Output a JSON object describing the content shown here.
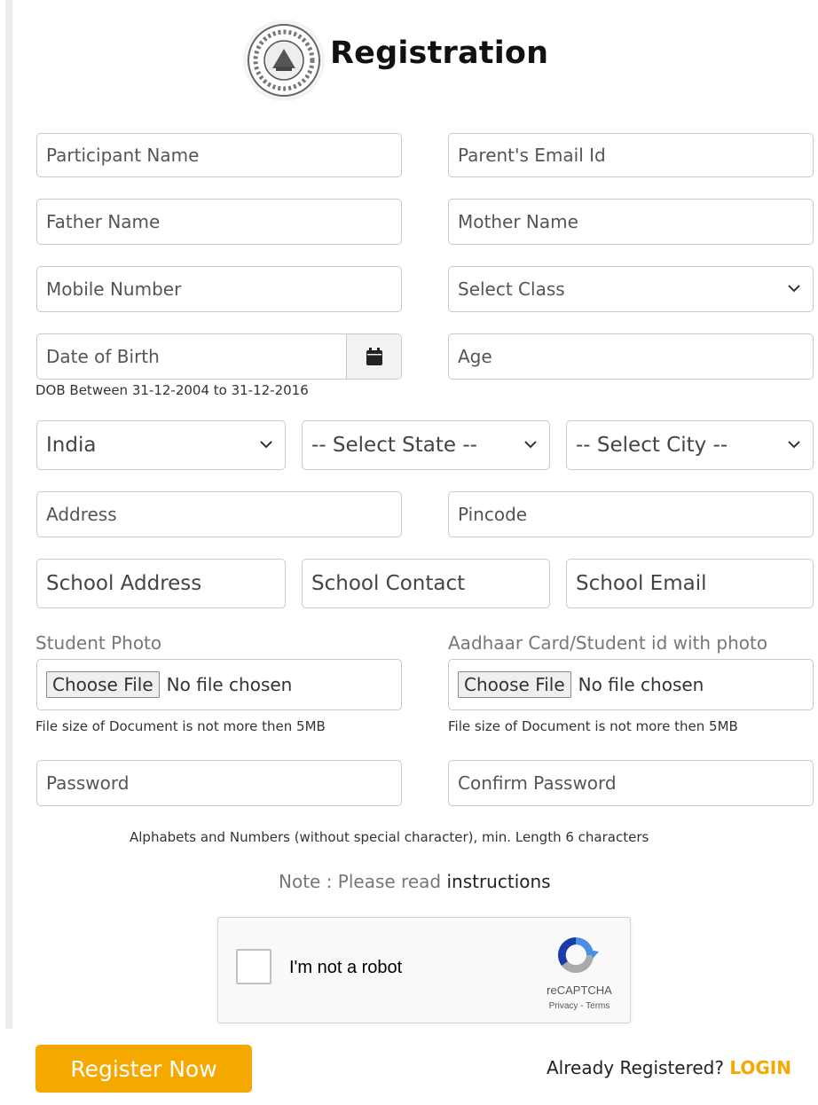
{
  "header": {
    "title": "Registration",
    "logo_icon": "emblem-logo"
  },
  "form": {
    "participant_name": "Participant Name",
    "parent_email": "Parent's Email Id",
    "father_name": "Father Name",
    "mother_name": "Mother Name",
    "mobile_number": "Mobile Number",
    "select_class": "Select Class",
    "date_of_birth": "Date of Birth",
    "age": "Age",
    "dob_hint": "DOB Between 31-12-2004 to 31-12-2016",
    "country": "India",
    "state": "-- Select State --",
    "city": "-- Select City --",
    "address": "Address",
    "pincode": "Pincode",
    "school_address": "School Address",
    "school_contact": "School Contact",
    "school_email": "School Email",
    "student_photo_label": "Student Photo",
    "aadhaar_label": "Aadhaar Card/Student id with photo",
    "choose_file": "Choose File",
    "no_file": "No file chosen",
    "file_size_hint": "File size of Document is not more then 5MB",
    "password": "Password",
    "confirm_password": "Confirm Password",
    "password_hint": "Alphabets and Numbers (without special character), min. Length 6 characters",
    "note_prefix": "Note : Please read",
    "note_link": "instructions"
  },
  "captcha": {
    "label": "I'm not a robot",
    "brand": "reCAPTCHA",
    "links": "Privacy - Terms"
  },
  "footer": {
    "register_button": "Register Now",
    "already_text": "Already Registered?",
    "login_link": "LOGIN"
  },
  "colors": {
    "accent": "#f5a800",
    "border": "#c9c9c9"
  }
}
